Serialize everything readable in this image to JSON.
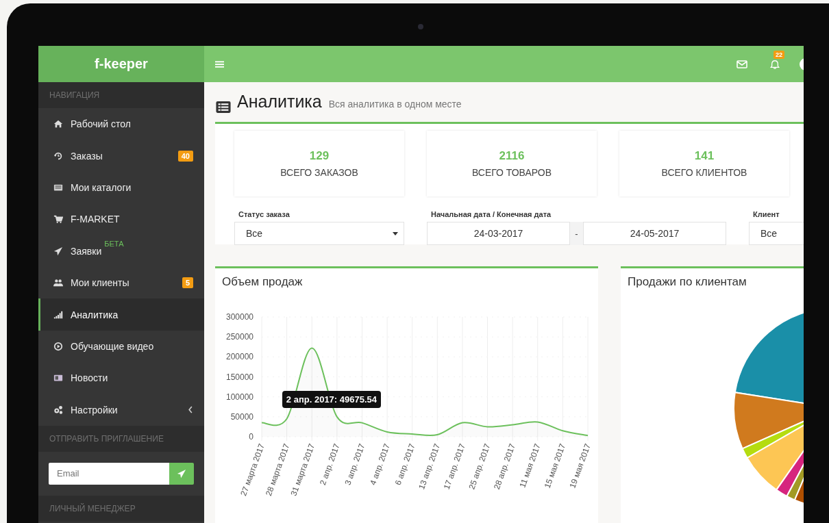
{
  "sidebar": {
    "logo": "f-keeper",
    "nav_heading": "НАВИГАЦИЯ",
    "items": [
      {
        "label": "Рабочий стол",
        "selected": false
      },
      {
        "label": "Заказы",
        "badge": "40",
        "selected": false
      },
      {
        "label": "Мои каталоги",
        "selected": false
      },
      {
        "label": "F-MARKET",
        "selected": false
      },
      {
        "label": "Заявки",
        "sup": "БЕТА",
        "selected": false
      },
      {
        "label": "Мои клиенты",
        "badge": "5",
        "selected": false
      },
      {
        "label": "Аналитика",
        "selected": true
      },
      {
        "label": "Обучающие видео",
        "selected": false
      },
      {
        "label": "Новости",
        "selected": false
      },
      {
        "label": "Настройки",
        "has_submenu": true,
        "selected": false
      }
    ],
    "invite_heading": "ОТПРАВИТЬ ПРИГЛАШЕНИЕ",
    "invite": {
      "placeholder": "Email"
    },
    "manager_heading": "ЛИЧНЫЙ МЕНЕДЖЕР"
  },
  "topbar": {
    "notifications": "22"
  },
  "page": {
    "title": "Аналитика",
    "subtitle": "Вся аналитика в одном месте"
  },
  "stats": [
    {
      "value": "129",
      "label": "ВСЕГО ЗАКАЗОВ"
    },
    {
      "value": "2116",
      "label": "ВСЕГО ТОВАРОВ"
    },
    {
      "value": "141",
      "label": "ВСЕГО КЛИЕНТОВ"
    }
  ],
  "filters": {
    "status": {
      "label": "Статус заказа",
      "value": "Все"
    },
    "dates": {
      "label": "Начальная дата / Конечная дата",
      "start": "24-03-2017",
      "separator": "-",
      "end": "24-05-2017"
    },
    "client": {
      "label": "Клиент",
      "value": "Все"
    }
  },
  "sales_panel": {
    "title": "Объем продаж",
    "tooltip": "2 апр. 2017: 49675.54",
    "chart_data": {
      "type": "line",
      "categories": [
        "27 марта 2017",
        "28 марта 2017",
        "31 марта 2017",
        "2 апр. 2017",
        "3 апр. 2017",
        "4 апр. 2017",
        "6 апр. 2017",
        "13 апр. 2017",
        "17 апр. 2017",
        "25 апр. 2017",
        "28 апр. 2017",
        "11 мая 2017",
        "15 мая 2017",
        "19 мая 2017"
      ],
      "series": [
        {
          "color": "#6cc05c",
          "values": [
            35000,
            45000,
            222000,
            50000,
            35000,
            12000,
            7000,
            5000,
            35000,
            25000,
            30000,
            37000,
            15000,
            3000
          ]
        }
      ],
      "ylim": [
        0,
        300000
      ],
      "grid": true,
      "yticks": [
        0,
        50000,
        100000,
        150000,
        200000,
        250000,
        300000
      ]
    }
  },
  "clients_panel": {
    "title": "Продажи по клиентам"
  }
}
